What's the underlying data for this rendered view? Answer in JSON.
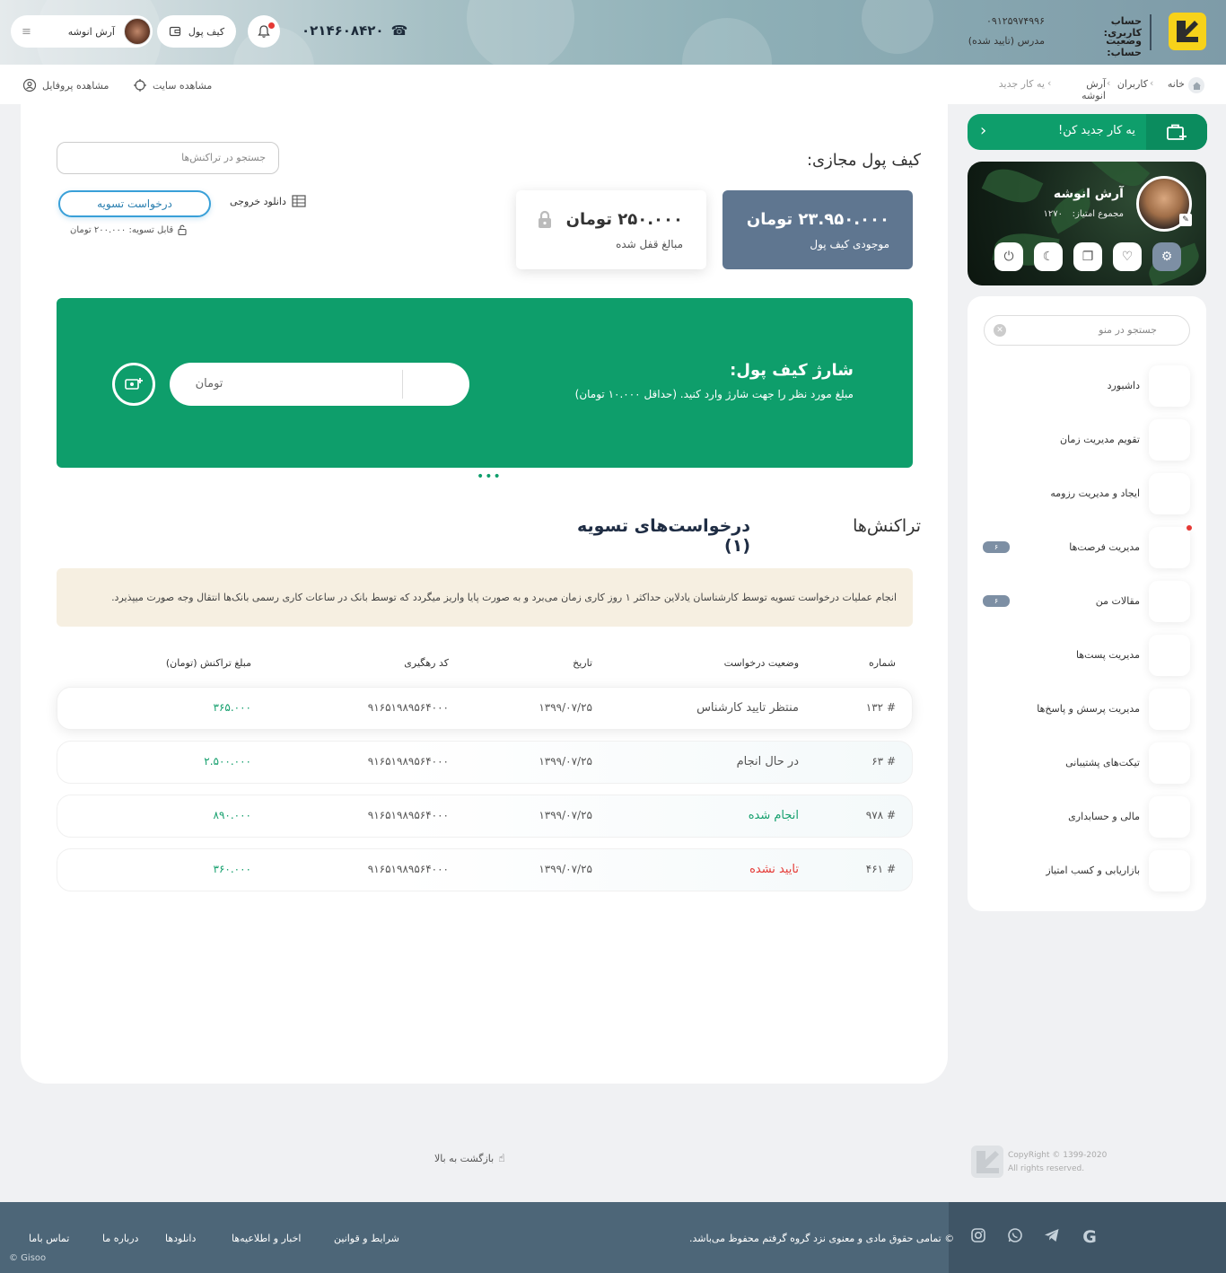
{
  "header": {
    "account_label": "حساب کاربری:",
    "account_value": "۰۹۱۲۵۹۷۴۹۹۶",
    "status_label": "وضعیت حساب:",
    "status_value": "مدرس (تایید شده)",
    "phone": "۰۲۱۴۶۰۸۴۲۰",
    "wallet_btn": "کیف پول",
    "user_name": "آرش انوشه"
  },
  "breadcrumb": [
    "خانه",
    "کاربران",
    "آرش انوشه",
    "یه کار جدید"
  ],
  "subbar": {
    "view_site": "مشاهده سایت",
    "view_profile": "مشاهده پروفایل"
  },
  "wallet": {
    "title": "کیف پول مجازی:",
    "search_placeholder": "جستجو در تراکنش‌ها",
    "balance_amount": "۲۳.۹۵۰.۰۰۰ تومان",
    "balance_label": "موجودی کیف پول",
    "locked_amount": "۲۵۰.۰۰۰ تومان",
    "locked_label": "مبالغ قفل شده",
    "download_output": "دانلود خروجی",
    "settle_request": "درخواست تسویه",
    "settleable": "قابل تسویه: ۲۰۰.۰۰۰ تومان"
  },
  "charge": {
    "title": "شارژ کیف پول:",
    "description": "مبلغ مورد نظر را جهت شارژ وارد کنید. (حداقل ۱۰.۰۰۰ تومان)",
    "unit": "تومان"
  },
  "tabs": {
    "transactions": "تراکنش‌ها",
    "settlements": "درخواست‌های تسویه (۱)"
  },
  "notice": "انجام عملیات درخواست تسویه توسط کارشناسان یادلاین حداکثر ۱ روز کاری زمان می‌برد و به صورت پایا واریز میگردد که توسط بانک در ساعات کاری رسمی بانک‌ها انتقال وجه صورت میپذیرد.",
  "table": {
    "headers": {
      "number": "شماره",
      "status": "وضعیت درخواست",
      "date": "تاریخ",
      "code": "کد رهگیری",
      "amount": "مبلغ تراکنش (تومان)"
    },
    "rows": [
      {
        "number": "# ۱۳۲",
        "status": "منتظر تایید کارشناس",
        "date": "۱۳۹۹/۰۷/۲۵",
        "code": "۹۱۶۵۱۹۸۹۵۶۴۰۰۰",
        "amount": "۳۶۵.۰۰۰"
      },
      {
        "number": "# ۶۳",
        "status": "در حال انجام",
        "date": "۱۳۹۹/۰۷/۲۵",
        "code": "۹۱۶۵۱۹۸۹۵۶۴۰۰۰",
        "amount": "۲.۵۰۰.۰۰۰"
      },
      {
        "number": "# ۹۷۸",
        "status": "انجام شده",
        "date": "۱۳۹۹/۰۷/۲۵",
        "code": "۹۱۶۵۱۹۸۹۵۶۴۰۰۰",
        "amount": "۸۹۰.۰۰۰"
      },
      {
        "number": "# ۴۶۱",
        "status": "تایید نشده",
        "date": "۱۳۹۹/۰۷/۲۵",
        "code": "۹۱۶۵۱۹۸۹۵۶۴۰۰۰",
        "amount": "۳۶۰.۰۰۰"
      }
    ]
  },
  "colors": {
    "status_pending": "#555555",
    "status_in_progress": "#555555",
    "status_done": "#16a06e",
    "status_rejected": "#e53935"
  },
  "sidebar": {
    "cta": "یه کار جدید کن!",
    "profile_name": "آرش انوشه",
    "profile_score_label": "مجموع امتیاز:",
    "profile_score": "۱۲۷۰",
    "menu_search_placeholder": "جستجو در منو",
    "items": [
      {
        "label": "داشبورد"
      },
      {
        "label": "تقویم مدیریت زمان"
      },
      {
        "label": "ایجاد و مدیریت رزومه"
      },
      {
        "label": "مدیریت فرصت‌ها",
        "badge": "۶"
      },
      {
        "label": "مقالات من",
        "badge": "۶"
      },
      {
        "label": "مدیریت پست‌ها"
      },
      {
        "label": "مدیریت پرسش و پاسخ‌ها"
      },
      {
        "label": "تیکت‌های پشتیبانی"
      },
      {
        "label": "مالی و حسابداری"
      },
      {
        "label": "بازاریابی و کسب امتیاز"
      }
    ]
  },
  "footer": {
    "back_to_top": "بازگشت به بالا",
    "copyright_line1": "CopyRight © 1399-2020",
    "copyright_line2": "All rights reserved.",
    "links": [
      "شرایط و قوانین",
      "اخبار و اطلاعیه‌ها",
      "دانلودها",
      "درباره ما",
      "تماس باما"
    ],
    "rights_notice": "© تمامی حقوق مادی و معنوی نزد گروه گرفتم محفوظ می‌باشد.",
    "brand": "© Gisoo"
  }
}
